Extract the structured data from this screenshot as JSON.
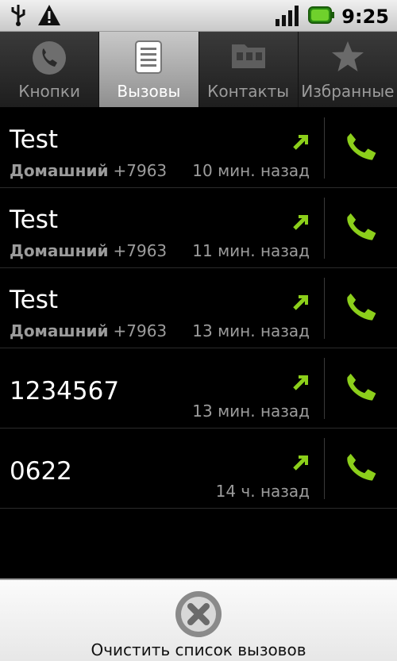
{
  "status_bar": {
    "time": "9:25",
    "icons": [
      "usb-icon",
      "warning-icon",
      "signal-icon",
      "battery-icon"
    ]
  },
  "tabs": [
    {
      "label": "Кнопки",
      "icon": "phone-icon",
      "active": false
    },
    {
      "label": "Вызовы",
      "icon": "call-log-icon",
      "active": true
    },
    {
      "label": "Контакты",
      "icon": "contacts-icon",
      "active": false
    },
    {
      "label": "Избранные",
      "icon": "star-icon",
      "active": false
    }
  ],
  "calls": [
    {
      "name": "Test",
      "type": "Домашний",
      "number": "+7963",
      "time": "10 мин. назад"
    },
    {
      "name": "Test",
      "type": "Домашний",
      "number": "+7963",
      "time": "11 мин. назад"
    },
    {
      "name": "Test",
      "type": "Домашний",
      "number": "+7963",
      "time": "13 мин. назад"
    },
    {
      "name": "1234567",
      "type": "",
      "number": "",
      "time": "13 мин. назад"
    },
    {
      "name": "0622",
      "type": "",
      "number": "",
      "time": "14 ч. назад"
    }
  ],
  "menu": {
    "clear_label": "Очистить список вызовов"
  },
  "colors": {
    "accent_green": "#8ccf1b",
    "tab_active": "#b0b0b0"
  }
}
